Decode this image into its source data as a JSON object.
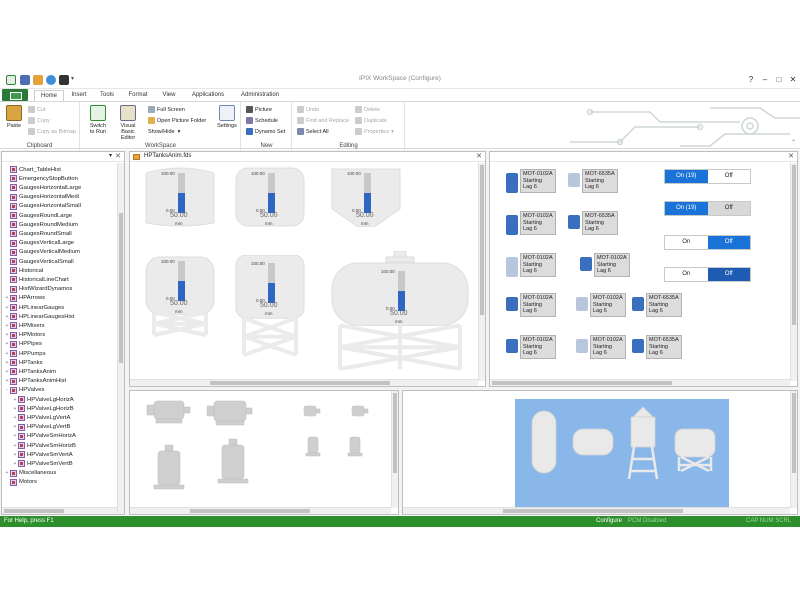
{
  "app": {
    "title": "IPIX WorkSpace (Configure)"
  },
  "ribbon": {
    "tabs": [
      "Home",
      "Insert",
      "Tools",
      "Format",
      "View",
      "Applications",
      "Administration"
    ],
    "active_tab": "Home",
    "clipboard": {
      "paste": "Paste",
      "cut": "Cut",
      "copy": "Copy",
      "copy_bitmap": "Copy as Bitmap",
      "group": "Clipboard"
    },
    "workspace": {
      "switch_to_run_1": "Switch",
      "switch_to_run_2": "to Run",
      "vbe_1": "Visual",
      "vbe_2": "Basic Editor",
      "full_screen": "Full Screen",
      "open_picture_folder": "Open Picture Folder",
      "show_hide": "Show/Hide",
      "settings": "Settings",
      "group": "WorkSpace"
    },
    "new": {
      "picture": "Picture",
      "schedule": "Schedule",
      "dynamo_set": "Dynamo Set",
      "group": "New"
    },
    "editing": {
      "undo": "Undo",
      "find_replace": "Find and Replace",
      "select_all": "Select All",
      "delete": "Delete",
      "duplicate": "Duplicate",
      "properties": "Properties",
      "group": "Editing"
    }
  },
  "tree": {
    "items": [
      {
        "label": "Chart_TableHist",
        "exp": ""
      },
      {
        "label": "EmergencyStopButton",
        "exp": ""
      },
      {
        "label": "GaugesHorizontalLarge",
        "exp": ""
      },
      {
        "label": "GaugesHorizontalMedi",
        "exp": ""
      },
      {
        "label": "GaugesHorizontalSmall",
        "exp": ""
      },
      {
        "label": "GaugesRoundLarge",
        "exp": ""
      },
      {
        "label": "GaugesRoundMedium",
        "exp": ""
      },
      {
        "label": "GaugesRoundSmall",
        "exp": ""
      },
      {
        "label": "GaugesVerticalLarge",
        "exp": ""
      },
      {
        "label": "GaugesVerticalMedium",
        "exp": ""
      },
      {
        "label": "GaugesVerticalSmall",
        "exp": ""
      },
      {
        "label": "Historical",
        "exp": ""
      },
      {
        "label": "HistoricalLineChart",
        "exp": ""
      },
      {
        "label": "HistWizardDynamos",
        "exp": ""
      },
      {
        "label": "HPArrows",
        "exp": "+"
      },
      {
        "label": "HPLinearGauges",
        "exp": "+"
      },
      {
        "label": "HPLinearGaugesHist",
        "exp": "+"
      },
      {
        "label": "HPMixers",
        "exp": "+"
      },
      {
        "label": "HPMotors",
        "exp": "+"
      },
      {
        "label": "HPPipes",
        "exp": "+"
      },
      {
        "label": "HPPumps",
        "exp": "+"
      },
      {
        "label": "HPTanks",
        "exp": "+"
      },
      {
        "label": "HPTanksAnim",
        "exp": "+"
      },
      {
        "label": "HPTanksAnimHist",
        "exp": "+"
      },
      {
        "label": "HPValves",
        "exp": "-"
      },
      {
        "label": "HPValveLgHorizA",
        "exp": "+"
      },
      {
        "label": "HPValveLgHorizB",
        "exp": "+"
      },
      {
        "label": "HPValveLgVertA",
        "exp": "+"
      },
      {
        "label": "HPValveLgVertB",
        "exp": "+"
      },
      {
        "label": "HPValveSmHorizA",
        "exp": "+"
      },
      {
        "label": "HPValveSmHorizB",
        "exp": "+"
      },
      {
        "label": "HPValveSmVertA",
        "exp": "+"
      },
      {
        "label": "HPValveSmVertB",
        "exp": "+"
      },
      {
        "label": "Miscellaneous",
        "exp": "+"
      },
      {
        "label": "Motors",
        "exp": ""
      }
    ]
  },
  "tanks_pane": {
    "title": "HPTanksAnim.fds",
    "gauge_max": "100.00",
    "gauge_min": "0.00",
    "gauge_value": "50.00",
    "unit": "mm",
    "level": 0.5
  },
  "motors_pane": {
    "labels": [
      {
        "tag": "MOT-0102A",
        "line1": "Starting",
        "line2": "Lag 6"
      },
      {
        "tag": "MOT-6535A",
        "line1": "Starting",
        "line2": "Lag 6"
      },
      {
        "tag": "MOT-0102A",
        "line1": "Starting",
        "line2": "Lag 6"
      },
      {
        "tag": "MOT-6535A",
        "line1": "Starting",
        "line2": "Lag 6"
      },
      {
        "tag": "MOT-0102A",
        "line1": "Starting",
        "line2": "Lag 6"
      },
      {
        "tag": "MOT-0102A",
        "line1": "Starting",
        "line2": "Lag 6"
      },
      {
        "tag": "MOT-0102A",
        "line1": "Starting",
        "line2": "Lag 6"
      },
      {
        "tag": "MOT-0102A",
        "line1": "Starting",
        "line2": "Lag 6"
      },
      {
        "tag": "MOT-6535A",
        "line1": "Starting",
        "line2": "Lag 6"
      },
      {
        "tag": "MOT-0102A",
        "line1": "Starting",
        "line2": "Lag 6"
      },
      {
        "tag": "MOT-0102A",
        "line1": "Starting",
        "line2": "Lag 6"
      },
      {
        "tag": "MOT-6535A",
        "line1": "Starting",
        "line2": "Lag 6"
      }
    ],
    "toggles": [
      {
        "on": "On (19)",
        "off": "Off"
      },
      {
        "on": "On (19)",
        "off": "Off"
      },
      {
        "on": "On",
        "off": "Off"
      },
      {
        "on": "On",
        "off": "Off"
      }
    ]
  },
  "statusbar": {
    "help": "For Help, press F1",
    "mode": "Configure",
    "pcm": "PCM Disabled",
    "keys": "CAP  NUM  SCRL"
  },
  "colors": {
    "accent_green": "#2c8f2c",
    "level_blue": "#2f66c4",
    "toggle_blue": "#1a73d9",
    "toggle_dark": "#1e5bb3"
  }
}
